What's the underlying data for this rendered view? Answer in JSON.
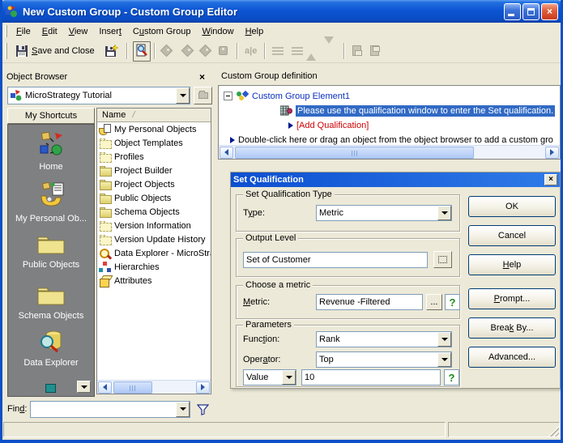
{
  "window": {
    "title": "New Custom Group - Custom Group Editor"
  },
  "menu": {
    "items": [
      {
        "pre": "",
        "key": "F",
        "post": "ile"
      },
      {
        "pre": "",
        "key": "E",
        "post": "dit"
      },
      {
        "pre": "",
        "key": "V",
        "post": "iew"
      },
      {
        "pre": "Inser",
        "key": "t",
        "post": ""
      },
      {
        "pre": "C",
        "key": "u",
        "post": "stom Group"
      },
      {
        "pre": "",
        "key": "W",
        "post": "indow"
      },
      {
        "pre": "",
        "key": "H",
        "post": "elp"
      }
    ]
  },
  "toolbar": {
    "save_and_close": {
      "pre": "",
      "key": "S",
      "post": "ave and Close"
    }
  },
  "browser": {
    "title": "Object Browser",
    "project": "MicroStrategy Tutorial",
    "shortcuts_title": "My Shortcuts",
    "shortcuts": [
      {
        "label": "Home",
        "icon": "home-icon"
      },
      {
        "label": "My Personal Ob...",
        "icon": "personal-objects-icon"
      },
      {
        "label": "Public Objects",
        "icon": "folder-icon"
      },
      {
        "label": "Schema Objects",
        "icon": "folder-icon"
      },
      {
        "label": "Data Explorer",
        "icon": "data-explorer-icon"
      }
    ],
    "column": "Name",
    "items": [
      {
        "label": "My Personal Objects",
        "icon": "personal"
      },
      {
        "label": "Object Templates",
        "icon": "folder-dashed"
      },
      {
        "label": "Profiles",
        "icon": "folder-dashed"
      },
      {
        "label": "Project Builder",
        "icon": "folder"
      },
      {
        "label": "Project Objects",
        "icon": "folder"
      },
      {
        "label": "Public Objects",
        "icon": "folder"
      },
      {
        "label": "Schema Objects",
        "icon": "folder"
      },
      {
        "label": "Version Information",
        "icon": "folder-dashed"
      },
      {
        "label": "Version Update History",
        "icon": "folder-dashed"
      },
      {
        "label": "Data Explorer - MicroStra",
        "icon": "explorer"
      },
      {
        "label": "Hierarchies",
        "icon": "hierarchy"
      },
      {
        "label": "Attributes",
        "icon": "attribute"
      }
    ],
    "find": {
      "pre": "Fin",
      "key": "d",
      "post": ":",
      "value": ""
    }
  },
  "definition": {
    "title": "Custom Group definition",
    "element": "Custom Group Element1",
    "selected": "Please use the qualification window to enter the Set qualification.",
    "add_qualification": "[Add Qualification]",
    "hint": "Double-click here or drag an object from the object browser to add a custom gro"
  },
  "dialog": {
    "title": "Set Qualification",
    "groups": {
      "type": "Set Qualification Type",
      "output": "Output Level",
      "metric": "Choose a metric",
      "params": "Parameters"
    },
    "labels": {
      "type": {
        "pre": "T",
        "key": "y",
        "post": "pe:"
      },
      "metric": {
        "pre": "",
        "key": "M",
        "post": "etric:"
      },
      "function": {
        "pre": "Func",
        "key": "t",
        "post": "ion:"
      },
      "operator": {
        "pre": "Oper",
        "key": "a",
        "post": "tor:"
      }
    },
    "values": {
      "type": "Metric",
      "output": "Set of Customer",
      "metric": "Revenue -Filtered",
      "function": "Rank",
      "operator": "Top",
      "value_type": "Value",
      "value": "10"
    },
    "buttons": {
      "ok": "OK",
      "cancel": "Cancel",
      "help": {
        "pre": "",
        "key": "H",
        "post": "elp"
      },
      "prompt": {
        "pre": "",
        "key": "P",
        "post": "rompt..."
      },
      "break_by": {
        "pre": "Brea",
        "key": "k",
        "post": " By..."
      },
      "advanced": "Advanced...",
      "ellipsis": "..."
    }
  },
  "icons": {
    "app": "microstrategy-logo",
    "titlebar": [
      "minimize-icon",
      "maximize-icon",
      "close-icon"
    ],
    "toolbar_enabled": [
      "save-icon",
      "save-new-icon",
      "view-filter-icon"
    ],
    "combo": "dropdown-arrow-icon",
    "find": "filter-funnel-icon",
    "browse": "ellipsis-button, dotted-select-icon, help-validate-icon"
  },
  "colors": {
    "accent": "#0A50C8",
    "selection": "#316AC5",
    "element_link": "#0B2FBF",
    "alert_red": "#CC0000",
    "chrome_beige": "#ECE9D8",
    "sidebar_gray": "#7F8082"
  }
}
